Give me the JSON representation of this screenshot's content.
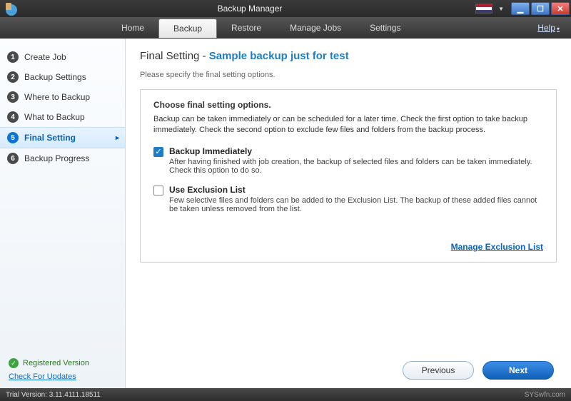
{
  "window": {
    "title": "Backup Manager",
    "help_label": "Help",
    "buttons": {
      "min": "▁",
      "max": "☐",
      "close": "✕"
    }
  },
  "menu": {
    "items": [
      {
        "label": "Home"
      },
      {
        "label": "Backup"
      },
      {
        "label": "Restore"
      },
      {
        "label": "Manage Jobs"
      },
      {
        "label": "Settings"
      }
    ],
    "active_index": 1
  },
  "sidebar": {
    "steps": [
      {
        "num": "1",
        "label": "Create Job"
      },
      {
        "num": "2",
        "label": "Backup Settings"
      },
      {
        "num": "3",
        "label": "Where to Backup"
      },
      {
        "num": "4",
        "label": "What to Backup"
      },
      {
        "num": "5",
        "label": "Final Setting"
      },
      {
        "num": "6",
        "label": "Backup Progress"
      }
    ],
    "active_index": 4,
    "registered_label": "Registered Version",
    "updates_label": "Check For Updates"
  },
  "page": {
    "title_prefix": "Final Setting",
    "title_sep": " - ",
    "title_highlight": "Sample backup just for test",
    "subtitle": "Please specify the final setting options.",
    "panel": {
      "heading": "Choose final setting options.",
      "intro": "Backup can be taken immediately or can be scheduled for a later time. Check the first option to take backup immediately. Check the second option to exclude few files and folders from the backup process.",
      "options": [
        {
          "checked": true,
          "label": "Backup Immediately",
          "desc": "After having finished with job creation, the backup of selected files and folders can be taken immediately. Check this option to do so."
        },
        {
          "checked": false,
          "label": "Use Exclusion List",
          "desc": "Few selective files and folders can be added to the Exclusion List. The backup of these added files cannot be taken unless removed from the list."
        }
      ],
      "manage_link": "Manage Exclusion List"
    },
    "buttons": {
      "previous": "Previous",
      "next": "Next"
    }
  },
  "status": {
    "trial": "Trial Version: 3.11.4111.18511",
    "watermark": "SYSwfn.com"
  }
}
